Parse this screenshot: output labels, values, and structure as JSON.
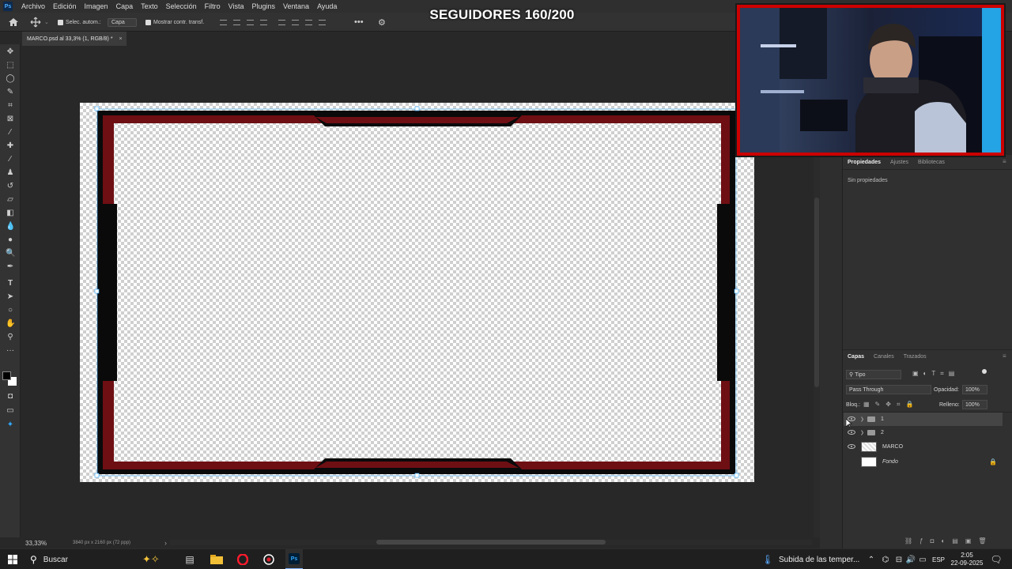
{
  "app": {
    "logo": "Ps"
  },
  "menu": [
    "Archivo",
    "Edición",
    "Imagen",
    "Capa",
    "Texto",
    "Selección",
    "Filtro",
    "Vista",
    "Plugins",
    "Ventana",
    "Ayuda"
  ],
  "options": {
    "auto_select_label": "Selec. autom.:",
    "auto_select_value": "Capa",
    "show_transform_label": "Mostrar contr. transf."
  },
  "overlay": {
    "title": "SEGUIDORES 160/200"
  },
  "document": {
    "tab_label": "MARCO.psd al 33,3% (1, RGB/8) *",
    "close": "×"
  },
  "status": {
    "zoom": "33,33%",
    "doc_size": "3840 px x 2160 px (72 ppp)",
    "arrow": "›"
  },
  "panels": {
    "properties_tabs": [
      "Propiedades",
      "Ajustes",
      "Bibliotecas"
    ],
    "properties_empty": "Sin propiedades",
    "layers_tabs": [
      "Capas",
      "Canales",
      "Trazados"
    ],
    "filter_kind": "Tipo",
    "blend_mode": "Pass Through",
    "opacity_label": "Opacidad:",
    "opacity_value": "100%",
    "lock_label": "Bloq.:",
    "fill_label": "Relleno:",
    "fill_value": "100%"
  },
  "layers": [
    {
      "name": "1",
      "type": "group",
      "visible": true,
      "selected": true
    },
    {
      "name": "2",
      "type": "group",
      "visible": true,
      "selected": false
    },
    {
      "name": "MARCO",
      "type": "layer",
      "visible": true,
      "selected": false
    },
    {
      "name": "Fondo",
      "type": "background",
      "visible": false,
      "locked": true,
      "selected": false
    }
  ],
  "frame": {
    "outer_color": "#0a0a0a",
    "inner_color": "#6e0f14"
  },
  "colors": {
    "accent": "#31a8ff",
    "stream_red": "#cc0000"
  },
  "taskbar": {
    "search_placeholder": "Buscar",
    "weather_text": "Subida de las temper...",
    "language": "ESP",
    "time": "2:05",
    "date": "22-09-2025"
  }
}
